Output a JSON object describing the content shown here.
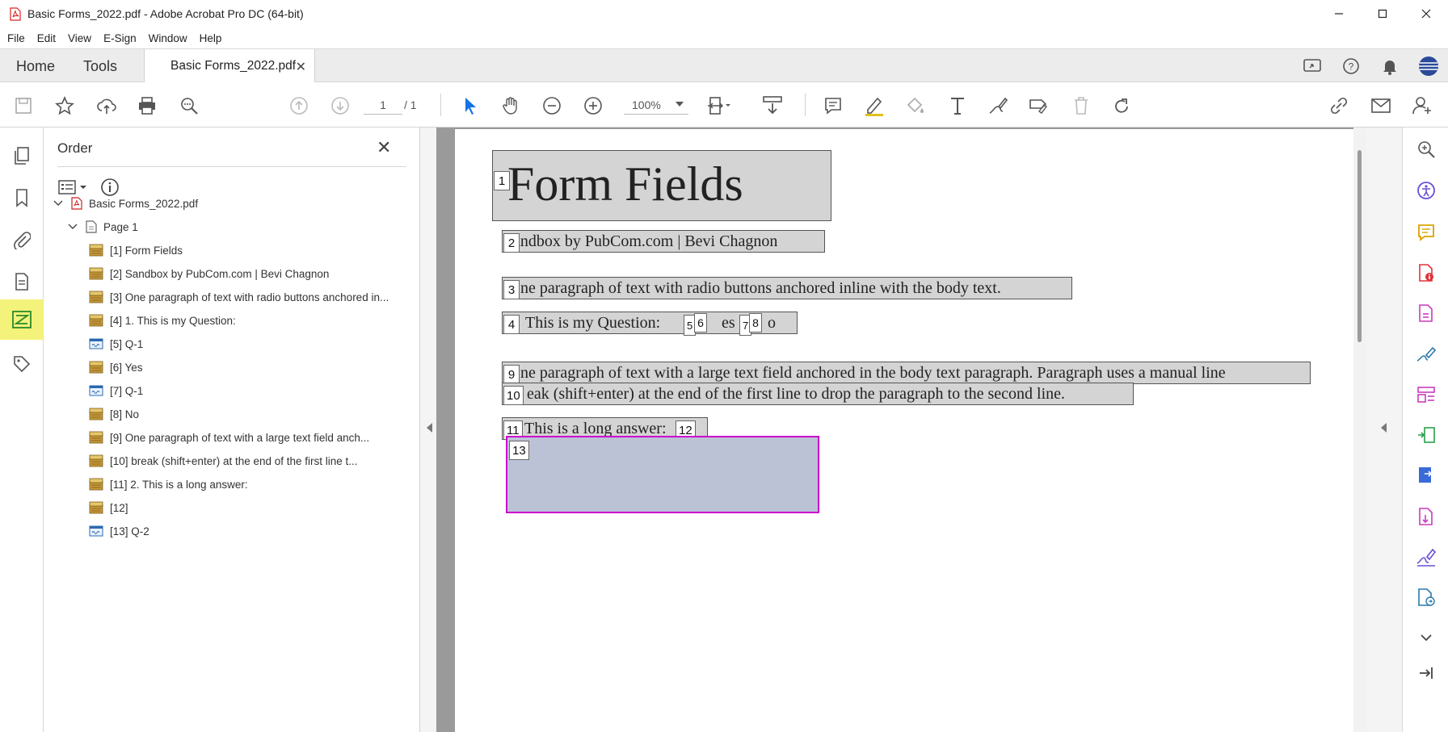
{
  "window": {
    "title": "Basic Forms_2022.pdf - Adobe Acrobat Pro DC (64-bit)"
  },
  "menu": [
    "File",
    "Edit",
    "View",
    "E-Sign",
    "Window",
    "Help"
  ],
  "tabs": {
    "home": "Home",
    "tools": "Tools",
    "document": "Basic Forms_2022.pdf"
  },
  "toolbar": {
    "page_current": "1",
    "page_total": "/ 1",
    "zoom": "100%"
  },
  "order_panel": {
    "title": "Order",
    "root": "Basic Forms_2022.pdf",
    "page": "Page 1",
    "items": [
      {
        "label": "[1]  Form Fields",
        "kind": "tag"
      },
      {
        "label": "[2]  Sandbox by PubCom.com | Bevi Chagnon",
        "kind": "tag"
      },
      {
        "label": "[3]  One paragraph of text with radio buttons anchored in...",
        "kind": "tag"
      },
      {
        "label": "[4]  1. This is my Question:",
        "kind": "tag"
      },
      {
        "label": "[5]  Q-1",
        "kind": "field"
      },
      {
        "label": "[6]  Yes",
        "kind": "tag"
      },
      {
        "label": "[7]  Q-1",
        "kind": "field"
      },
      {
        "label": "[8]  No",
        "kind": "tag"
      },
      {
        "label": "[9]  One paragraph of text with a large text field anch...",
        "kind": "tag"
      },
      {
        "label": "[10]  break (shift+enter) at the end of the first line t...",
        "kind": "tag"
      },
      {
        "label": "[11]  2. This is a long answer:",
        "kind": "tag"
      },
      {
        "label": "[12]",
        "kind": "tag"
      },
      {
        "label": "[13]  Q-2",
        "kind": "field"
      }
    ]
  },
  "document": {
    "title": "Form Fields",
    "subtitle": "andbox by PubCom.com | Bevi Chagnon",
    "para1": "ne paragraph of text with radio buttons anchored inline with the body text.",
    "question": "This is my Question:",
    "yes": "es",
    "no": "o",
    "para2_line1": "ne paragraph of text with a large text field anchored in the body text paragraph. Paragraph uses a manual line",
    "para2_line2": "eak (shift+enter) at the end of the first line to drop the paragraph to the second line.",
    "long_answer": "This is a long answer:",
    "badges": [
      "1",
      "2",
      "3",
      "4",
      "5",
      "6",
      "7",
      "8",
      "9",
      "10",
      "11",
      "12",
      "13"
    ]
  },
  "colors": {
    "active_rail": "#f3f27a",
    "field_border": "#cc00cc",
    "field_fill": "#bcc2d6",
    "tag_fill": "#d4d4d4"
  }
}
